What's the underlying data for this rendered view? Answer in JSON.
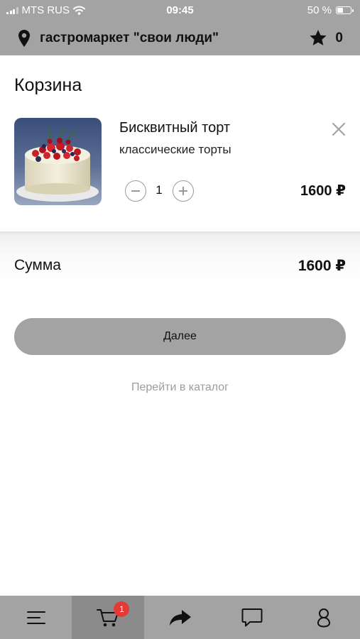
{
  "status_bar": {
    "carrier": "MTS RUS",
    "time": "09:45",
    "battery_percent": "50 %",
    "battery_level": 0.5,
    "signal_icon": "signal-bars-icon",
    "wifi_icon": "wifi-icon",
    "battery_icon": "battery-icon"
  },
  "header": {
    "location_icon": "location-pin-icon",
    "store_name": "гастромаркет \"свои люди\"",
    "favorites_icon": "star-icon",
    "favorites_count": "0"
  },
  "cart": {
    "title": "Корзина",
    "items": [
      {
        "image": "cake-photo",
        "name": "Бисквитный торт",
        "category": "классические торты",
        "quantity": "1",
        "price": "1600 ₽",
        "remove_icon": "close-icon",
        "minus_icon": "minus-circle-icon",
        "plus_icon": "plus-circle-icon"
      }
    ],
    "sum_label": "Сумма",
    "sum_value": "1600 ₽",
    "next_label": "Далее",
    "catalog_link": "Перейти в каталог"
  },
  "tab_bar": {
    "items": [
      {
        "icon": "menu-icon",
        "active": false
      },
      {
        "icon": "cart-icon",
        "active": true,
        "badge": "1"
      },
      {
        "icon": "share-arrow-icon",
        "active": false
      },
      {
        "icon": "chat-icon",
        "active": false
      },
      {
        "icon": "profile-icon",
        "active": false
      }
    ]
  },
  "colors": {
    "bar_gray": "#a3a3a3",
    "active_tab": "#8b8b8b",
    "badge_red": "#e53935",
    "muted_text": "#9c9c9c"
  }
}
